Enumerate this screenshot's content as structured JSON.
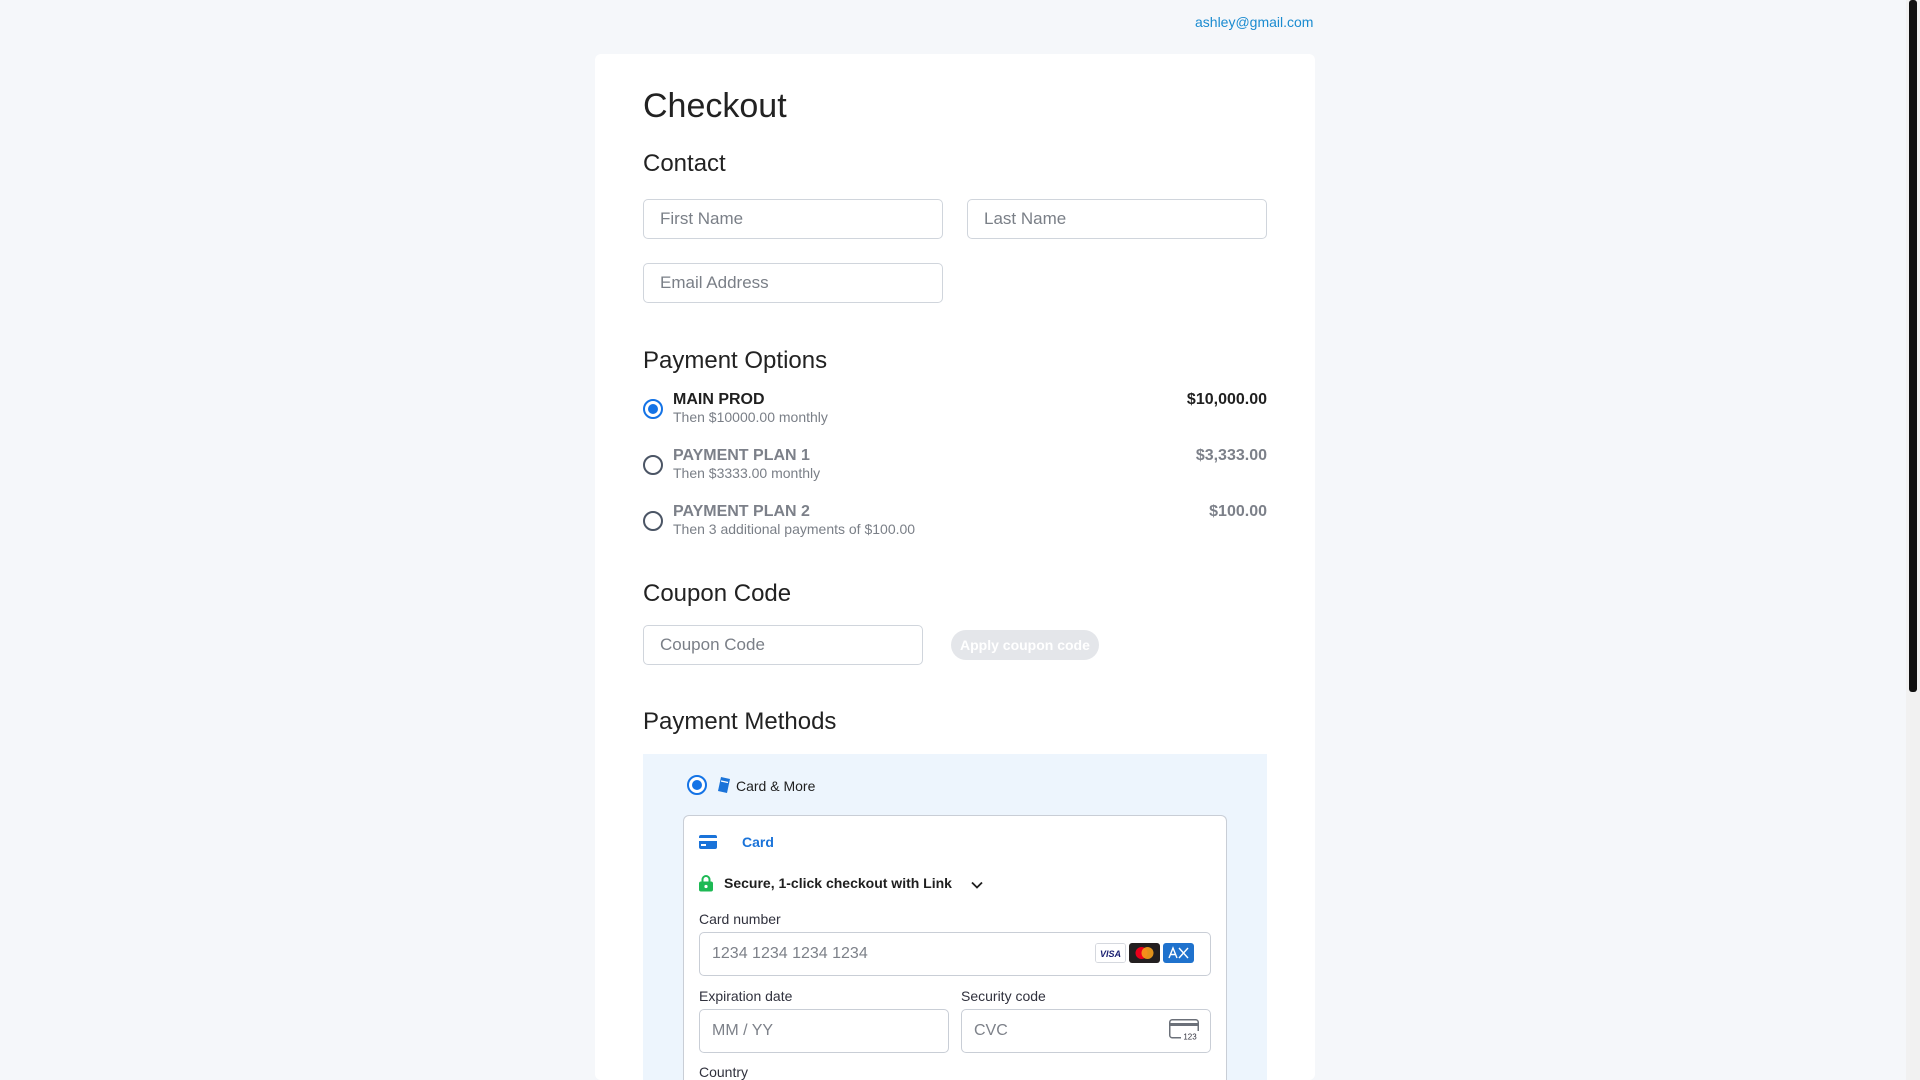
{
  "header": {
    "account_email": "ashley@gmail.com"
  },
  "checkout": {
    "title": "Checkout",
    "contact": {
      "heading": "Contact",
      "first_name_placeholder": "First Name",
      "last_name_placeholder": "Last Name",
      "email_placeholder": "Email Address"
    },
    "payment_options": {
      "heading": "Payment Options",
      "selected_index": 0,
      "plans": [
        {
          "name": "MAIN PROD",
          "subtitle": "Then $10000.00 monthly",
          "price": "$10,000.00"
        },
        {
          "name": "PAYMENT PLAN 1",
          "subtitle": "Then $3333.00 monthly",
          "price": "$3,333.00"
        },
        {
          "name": "PAYMENT PLAN 2",
          "subtitle": "Then 3 additional payments of $100.00",
          "price": "$100.00"
        }
      ]
    },
    "coupon": {
      "heading": "Coupon Code",
      "input_placeholder": "Coupon Code",
      "apply_label": "Apply coupon code"
    },
    "payment_methods": {
      "heading": "Payment Methods",
      "method_label": "Card & More",
      "card_tab_label": "Card",
      "link_label": "Secure, 1-click checkout with Link",
      "card_number_label": "Card number",
      "card_number_placeholder": "1234 1234 1234 1234",
      "card_brands": [
        "visa",
        "mastercard",
        "amex"
      ],
      "expiration_label": "Expiration date",
      "expiration_placeholder": "MM / YY",
      "security_label": "Security code",
      "security_placeholder": "CVC",
      "country_label": "Country"
    }
  },
  "colors": {
    "accent": "#1473e6",
    "link": "#1a8bd0",
    "page_bg": "#f5f7fa",
    "methods_bg": "#edf5fd",
    "lock_green": "#1db954"
  }
}
